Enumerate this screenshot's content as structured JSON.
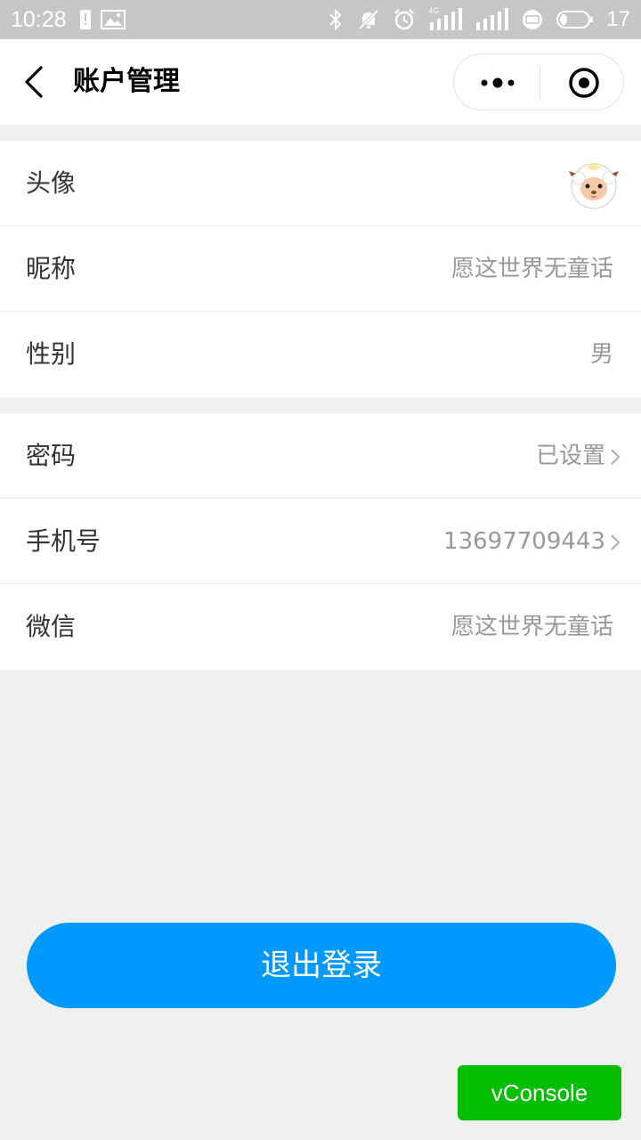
{
  "status_bar": {
    "time": "10:28",
    "network": "4G",
    "battery": "17"
  },
  "nav": {
    "title": "账户管理"
  },
  "profile_group": [
    {
      "label": "头像",
      "avatar_icon": "sheep-avatar-icon"
    },
    {
      "label": "昵称",
      "value": "愿这世界无童话"
    },
    {
      "label": "性别",
      "value": "男"
    }
  ],
  "security_group": [
    {
      "label": "密码",
      "value": "已设置"
    },
    {
      "label": "手机号",
      "value": "13697709443"
    },
    {
      "label": "微信",
      "value": "愿这世界无童话"
    }
  ],
  "logout_label": "退出登录",
  "vconsole_label": "vConsole",
  "colors": {
    "primary": "#0099ff",
    "vconsole": "#04be02",
    "status_bar": "#c6c6c6",
    "background": "#f0f0f0"
  }
}
